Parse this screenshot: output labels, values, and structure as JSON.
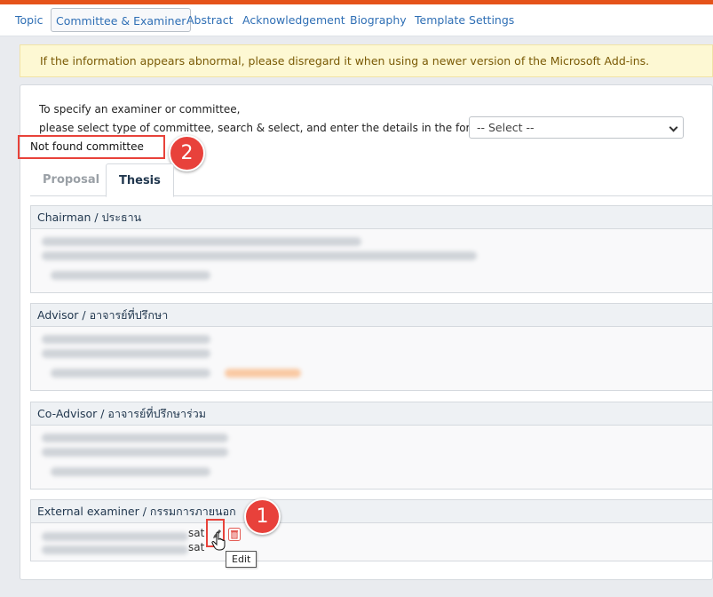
{
  "nav": {
    "items": [
      {
        "label": "Topic",
        "active": false
      },
      {
        "label": "Committee & Examiner",
        "active": true
      },
      {
        "label": "Abstract",
        "active": false
      },
      {
        "label": "Acknowledgement",
        "active": false
      },
      {
        "label": "Biography",
        "active": false
      },
      {
        "label": "Template Settings",
        "active": false
      }
    ]
  },
  "alert": {
    "text": "If the information appears abnormal, please disregard it when using a newer version of the Microsoft Add-ins."
  },
  "instructions": {
    "line1": "To specify an examiner or committee,",
    "line2": "please select type of committee, search & select, and enter the details in the form:"
  },
  "committee_select": {
    "value": "-- Select --"
  },
  "status": {
    "not_found": "Not found committee"
  },
  "tabs": [
    {
      "label": "Proposal",
      "active": false
    },
    {
      "label": "Thesis",
      "active": true
    }
  ],
  "panels": [
    {
      "title": "Chairman / ประธาน"
    },
    {
      "title": "Advisor / อาจารย์ที่ปรึกษา"
    },
    {
      "title": "Co-Advisor / อาจารย์ที่ปรึกษาร่วม"
    },
    {
      "title": "External examiner / กรรมการภายนอก",
      "visible_text_1": "sat",
      "visible_text_2": "sat"
    }
  ],
  "annotations": {
    "badge1": "1",
    "badge2": "2"
  },
  "tooltip": {
    "text": "Edit"
  },
  "icons": {
    "edit": "pencil-icon",
    "delete": "trash-icon"
  },
  "colors": {
    "accent": "#e5531a",
    "link": "#2f6fb5",
    "highlight": "#e8423a",
    "delete": "#e35b54"
  }
}
